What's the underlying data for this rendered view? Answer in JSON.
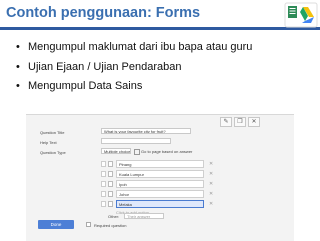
{
  "slide": {
    "title": "Contoh penggunaan: Forms",
    "bullets": [
      "Mengumpul maklumat dari ibu bapa atau guru",
      "Ujian Ejaan / Ujian Pendaraban",
      "Mengumpul Data Sains"
    ],
    "colors": {
      "title": "#3a6fb0",
      "rule": "#2f5aa0"
    }
  },
  "form_editor": {
    "toolbar_icons": [
      "edit-icon",
      "copy-icon",
      "delete-icon"
    ],
    "question_title_label": "Question Title",
    "question_title_value": "What is your favourite city for fruit?",
    "help_text_label": "Help Text",
    "question_type_label": "Question Type",
    "question_type_value": "Multiple choice",
    "go_to_page_label": "Go to page based on answer",
    "options": [
      "Pinang",
      "Kuala Lumpur",
      "Ipoh",
      "Johor",
      "Melaka"
    ],
    "add_option_text": "Click to add option",
    "other_label": "Other:",
    "other_placeholder": "Their answer",
    "done_label": "Done",
    "required_label": "Required question"
  }
}
